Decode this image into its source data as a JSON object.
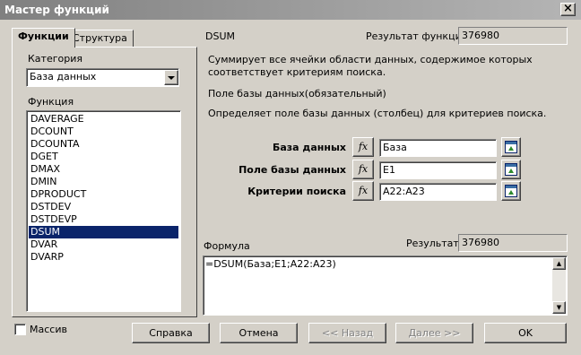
{
  "window": {
    "title": "Мастер функций",
    "close_icon": "×"
  },
  "tabs": [
    {
      "label": "Функции",
      "active": true
    },
    {
      "label": "Структура",
      "active": false
    }
  ],
  "category": {
    "label": "Категория",
    "value": "База данных"
  },
  "functions": {
    "label": "Функция",
    "items": [
      "DAVERAGE",
      "DCOUNT",
      "DCOUNTA",
      "DGET",
      "DMAX",
      "DMIN",
      "DPRODUCT",
      "DSTDEV",
      "DSTDEVP",
      "DSUM",
      "DVAR",
      "DVARP"
    ],
    "selected": "DSUM"
  },
  "detail": {
    "function_name": "DSUM",
    "result_label": "Результат функции",
    "result_value": "376980",
    "description": "Суммирует все ячейки области данных, содержимое которых соответствует критериям поиска.",
    "param_title": "Поле базы данных(обязательный)",
    "param_description": "Определяет поле базы данных (столбец) для критериев поиска."
  },
  "arguments": [
    {
      "label": "База данных",
      "value": "База"
    },
    {
      "label": "Поле базы данных",
      "value": "E1"
    },
    {
      "label": "Критерии поиска",
      "value": "A22:A23"
    }
  ],
  "fx_label": "fx",
  "formula": {
    "label": "Формула",
    "result_label": "Результат",
    "result_value": "376980",
    "value": "=DSUM(База;E1;A22:A23)"
  },
  "array_checkbox": {
    "label": "Массив",
    "checked": false
  },
  "buttons": {
    "help": "Справка",
    "cancel": "Отмена",
    "back": "<< Назад",
    "next": "Далее >>",
    "ok": "OK"
  }
}
